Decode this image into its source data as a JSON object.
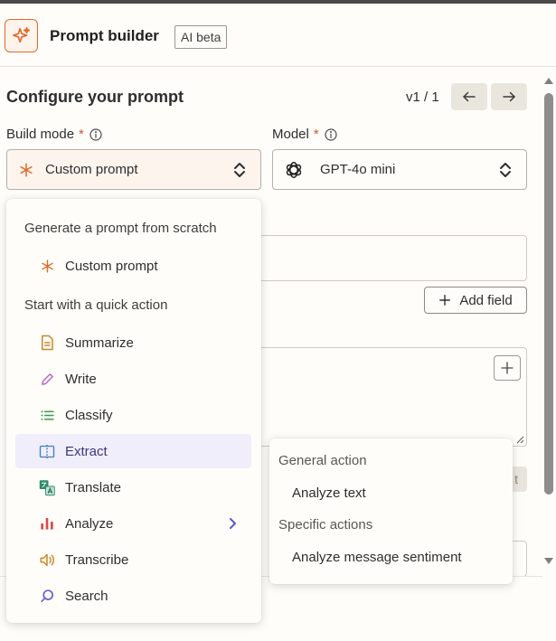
{
  "header": {
    "title": "Prompt builder",
    "badge": "AI beta",
    "logo_icon": "sparkle-icon",
    "accent_color": "#e0682b"
  },
  "configure": {
    "title": "Configure your prompt",
    "version": "v1 / 1",
    "prev_icon": "arrow-left-icon",
    "next_icon": "arrow-right-icon"
  },
  "build_mode": {
    "label": "Build mode",
    "required_mark": "*",
    "selected": "Custom prompt",
    "icon": "asterisk-icon"
  },
  "model": {
    "label": "Model",
    "required_mark": "*",
    "selected": "GPT-4o mini",
    "icon": "openai-icon"
  },
  "form": {
    "add_field_label": "Add field",
    "faded_button_label": "t"
  },
  "menu": {
    "scratch_heading": "Generate a prompt from scratch",
    "quick_heading": "Start with a quick action",
    "items": [
      {
        "label": "Custom prompt",
        "icon": "asterisk-icon",
        "color": "#e0682b"
      },
      {
        "label": "Summarize",
        "icon": "document-icon",
        "color": "#c8862a"
      },
      {
        "label": "Write",
        "icon": "pencil-icon",
        "color": "#b763c9"
      },
      {
        "label": "Classify",
        "icon": "list-icon",
        "color": "#3f9a4e"
      },
      {
        "label": "Extract",
        "icon": "extract-icon",
        "color": "#3d7fc4"
      },
      {
        "label": "Translate",
        "icon": "translate-icon",
        "color": "#2f8a6a"
      },
      {
        "label": "Analyze",
        "icon": "bar-chart-icon",
        "color": "#d64b4b"
      },
      {
        "label": "Transcribe",
        "icon": "speaker-icon",
        "color": "#c98a2a"
      },
      {
        "label": "Search",
        "icon": "search-icon",
        "color": "#5b57d1"
      }
    ]
  },
  "submenu": {
    "general_heading": "General action",
    "general_item": "Analyze text",
    "specific_heading": "Specific actions",
    "specific_item": "Analyze message sentiment"
  }
}
